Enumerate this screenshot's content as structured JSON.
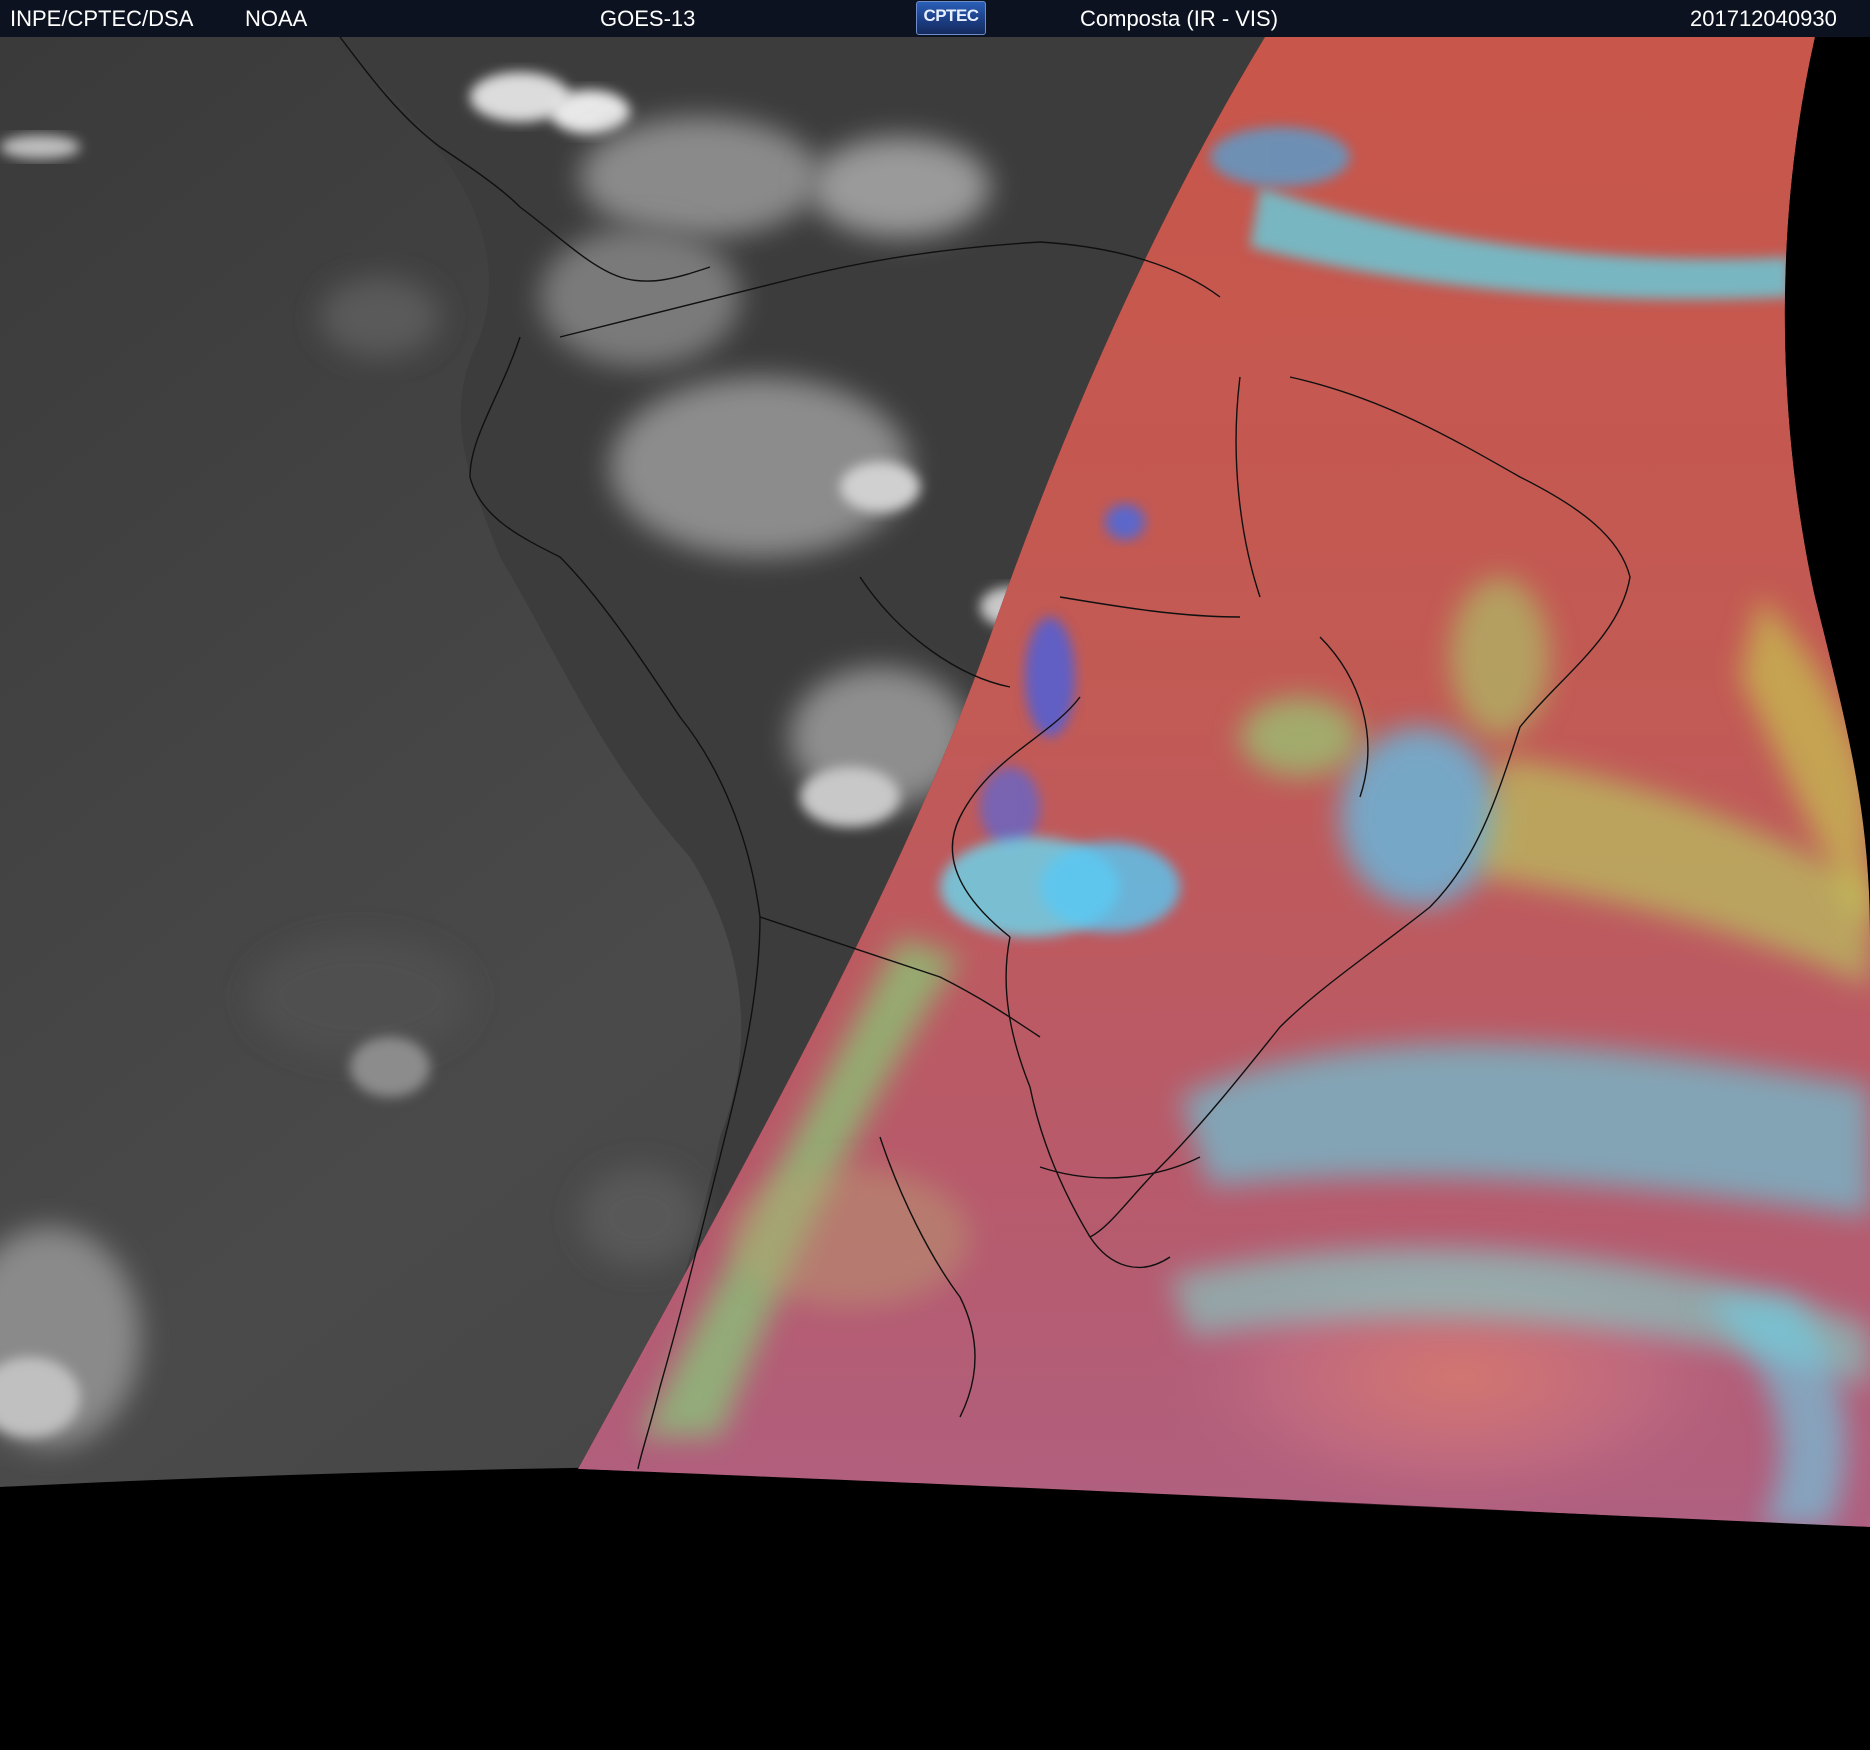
{
  "header": {
    "agency": "INPE/CPTEC/DSA",
    "source": "NOAA",
    "satellite": "GOES-13",
    "logo_text": "CPTEC",
    "product": "Composta (IR - VIS)",
    "timestamp": "201712040930"
  },
  "colors": {
    "header_bg": "#0c1220",
    "space": "#000000",
    "ir_night": "#4a4a4a",
    "vis_day_base": "#c45a4a",
    "cloud_cyan": "#5fd6e8",
    "cloud_green": "#8ee07a",
    "borders": "#101010"
  },
  "map": {
    "region": "South America",
    "scene": "satellite-composite",
    "night_side_render": "grayscale-ir",
    "day_side_render": "false-color-composite"
  }
}
